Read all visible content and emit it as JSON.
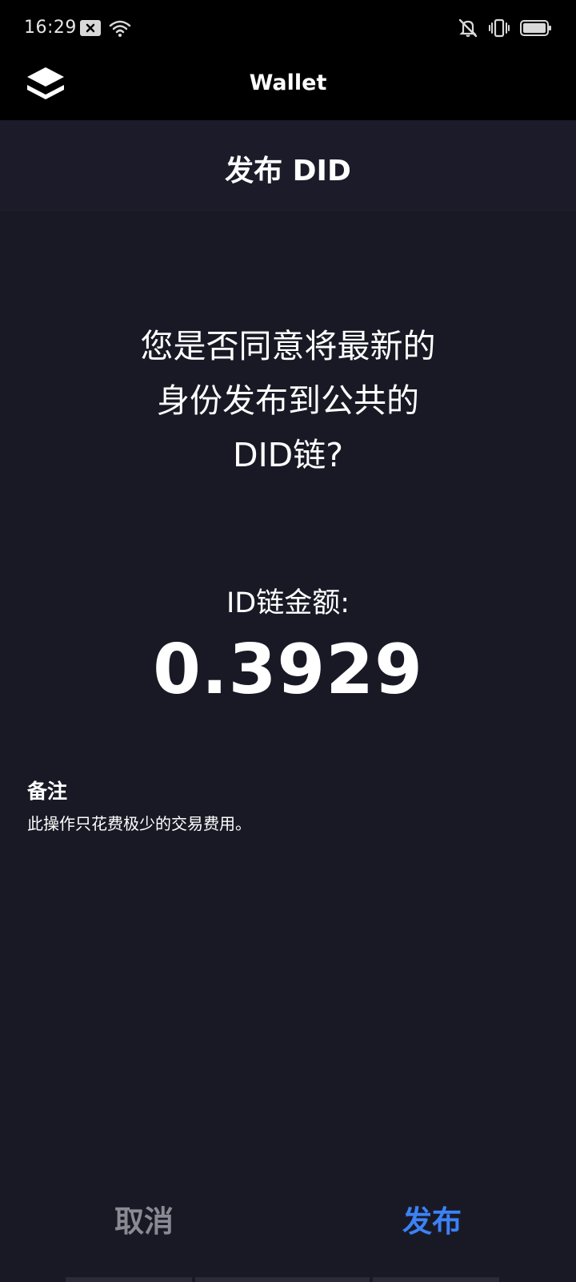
{
  "status_bar": {
    "time": "16:29",
    "left_icons": [
      "notification-close-icon",
      "wifi-icon"
    ],
    "right_icons": [
      "mute-bell-icon",
      "vibrate-icon",
      "battery-icon"
    ]
  },
  "app": {
    "title": "Wallet",
    "logo_icon": "layers-logo-icon"
  },
  "dialog": {
    "title": "发布 DID",
    "question_lines": [
      "您是否同意将最新的",
      "身份发布到公共的",
      "DID链?"
    ],
    "amount_label": "ID链金额:",
    "amount_value": "0.3929",
    "note_label": "备注",
    "note_text": "此操作只花费极少的交易费用。"
  },
  "actions": {
    "cancel_label": "取消",
    "publish_label": "发布"
  },
  "colors": {
    "background": "#191926",
    "header": "#000000",
    "accent": "#3b82f6",
    "muted": "#8a8a93"
  }
}
